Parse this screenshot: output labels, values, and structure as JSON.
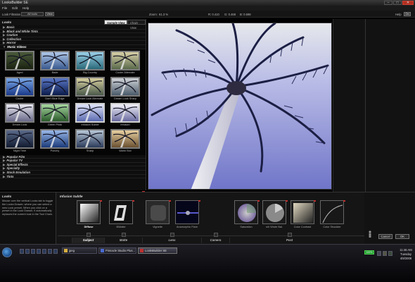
{
  "app": {
    "title": "LooksBuilder SE",
    "window_controls": [
      "–",
      "□",
      "✕"
    ]
  },
  "menu": [
    "File",
    "Edit",
    "Help"
  ],
  "toolbar": {
    "filter_label": "Look Filtration",
    "filter_value": "All tools",
    "view_button": "View",
    "zoom_label": "Zoom:",
    "zoom_value": "61.3 %",
    "r_label": "R: 0.410",
    "g_label": "G: 0.468",
    "b_label": "B: 0.698",
    "help_label": "Help",
    "help_button": "On"
  },
  "looks_panel": {
    "heading": "Looks",
    "tab_sample": "Sample View",
    "tab_chain": "Chain View",
    "categories_before": [
      "Basic",
      "Black and White Tints",
      "Caution",
      "Collection",
      "Horror",
      "Music Videos"
    ],
    "thumbnails": [
      {
        "label": "Aged"
      },
      {
        "label": "Bade"
      },
      {
        "label": "Big Country"
      },
      {
        "label": "Cooler Alternate"
      },
      {
        "label": "Cooler"
      },
      {
        "label": "Don't Blue Edge"
      },
      {
        "label": "Dream Look Alternate"
      },
      {
        "label": "Dream Look Sharp"
      },
      {
        "label": "Dream Look"
      },
      {
        "label": "Green Peak"
      },
      {
        "label": "Infusion Subtle"
      },
      {
        "label": "Infusion"
      },
      {
        "label": "Night Time"
      },
      {
        "label": "Punchy"
      },
      {
        "label": "Sharp"
      },
      {
        "label": "Warm Box"
      }
    ],
    "categories_after": [
      "Popular Film",
      "Popular TV",
      "Special Effects",
      "Specialty",
      "Stock Emulation",
      "Tints"
    ]
  },
  "info": {
    "heading": "Looks",
    "text": "Mouse over the vertical Looks tab to toggle the Looks Drawer, where you can select a new Look preset. When you click on a preset in the Look Drawer, it automatically replaces the current look in the Tool Chain."
  },
  "tool_chain": {
    "heading": "Infusion Subtle",
    "tools": [
      {
        "label": "Diffuse",
        "active": true
      },
      {
        "label": "B/Matte",
        "active": false
      },
      {
        "label": "Vignette",
        "active": false
      },
      {
        "label": "Anamorphic Flare",
        "active": false
      },
      {
        "label": "Saturation",
        "active": false
      },
      {
        "label": "s/h Wrote Bal.",
        "active": false
      },
      {
        "label": "Color Contrast",
        "active": false
      },
      {
        "label": "Color Shoulder",
        "active": false
      }
    ],
    "category_tabs": [
      "Subject",
      "Matte",
      "Lens",
      "Camera",
      "Post"
    ],
    "active_tab": "Subject"
  },
  "actions": {
    "cancel": "Cancel",
    "ok": "OK"
  },
  "taskbar": {
    "apps": [
      "jpeg",
      "Pinnacle Studio Plus...",
      "LooksBuilder SE"
    ],
    "battery": "100%",
    "time": "11:46 AM",
    "day": "Tuesday",
    "date": "4/8/2008"
  },
  "colors": {
    "accent_red": "#c03030",
    "preview_sky": "#8a8fd6",
    "battery_green": "#1aa02a"
  }
}
